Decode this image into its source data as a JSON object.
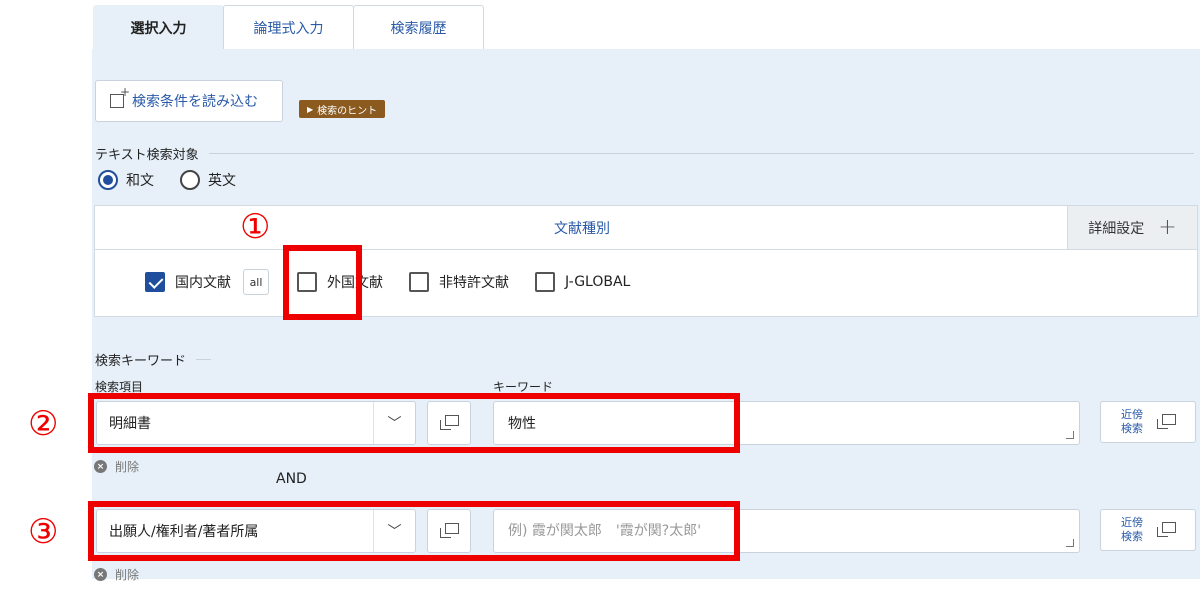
{
  "tabs": [
    {
      "label": "選択入力",
      "active": true
    },
    {
      "label": "論理式入力",
      "active": false
    },
    {
      "label": "検索履歴",
      "active": false
    }
  ],
  "toolbar": {
    "load_label": "検索条件を読み込む",
    "hint_label": "検索のヒント"
  },
  "text_target": {
    "title": "テキスト検索対象",
    "options": [
      {
        "label": "和文",
        "selected": true
      },
      {
        "label": "英文",
        "selected": false
      }
    ]
  },
  "doc_types": {
    "header": "文献種別",
    "detail_label": "詳細設定",
    "all_label": "all",
    "options": [
      {
        "label": "国内文献",
        "checked": true
      },
      {
        "label": "外国文献",
        "checked": false
      },
      {
        "label": "非特許文献",
        "checked": false
      },
      {
        "label": "J-GLOBAL",
        "checked": false
      }
    ]
  },
  "keywords": {
    "title": "検索キーワード",
    "field_label": "検索項目",
    "keyword_label": "キーワード",
    "near_label_1": "近傍",
    "near_label_2": "検索",
    "delete_label": "削除",
    "operator": "AND",
    "rows": [
      {
        "field": "明細書",
        "value": "物性",
        "placeholder": ""
      },
      {
        "field": "出願人/権利者/著者所属",
        "value": "",
        "placeholder": "例) 霞が関太郎　'霞が関?太郎'"
      }
    ]
  },
  "annotations": [
    "①",
    "②",
    "③"
  ],
  "colors": {
    "accent": "#2a5aa8",
    "panel": "#e7f0f9",
    "annotation": "#ee0000",
    "hint_badge": "#8a5a1e"
  }
}
